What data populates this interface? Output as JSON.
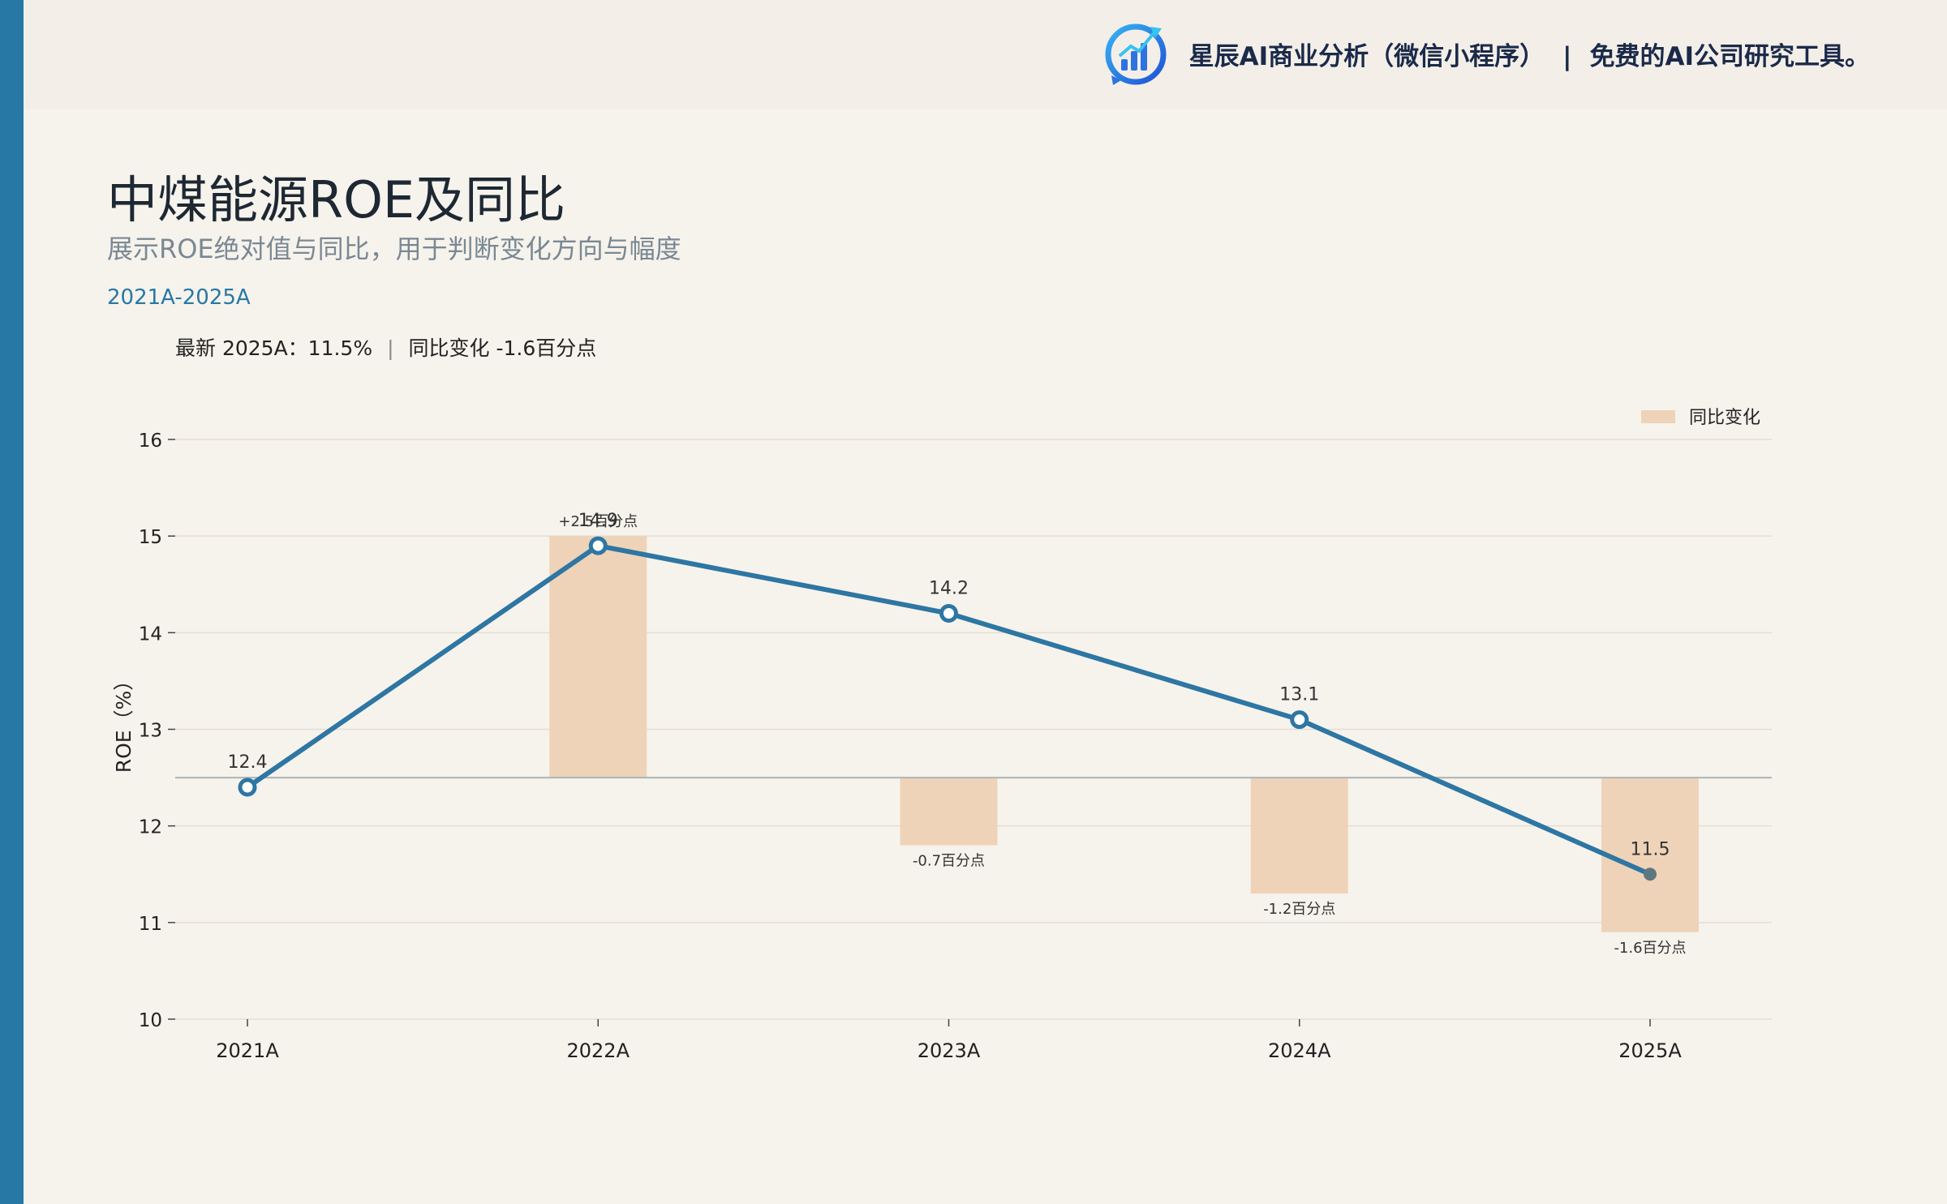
{
  "header": {
    "brand_name": "星辰AI商业分析（微信小程序）",
    "separator": "|",
    "tagline": "免费的AI公司研究工具。"
  },
  "title": "中煤能源ROE及同比",
  "subtitle": "展示ROE绝对值与同比，用于判断变化方向与幅度",
  "period": "2021A-2025A",
  "latest": {
    "label": "最新 2025A：11.5%",
    "separator": "|",
    "change": "同比变化 -1.6百分点"
  },
  "colors": {
    "accent": "#2878a5",
    "line": "#2e76a3",
    "bar": "#efd3b8",
    "last_point": "#5f7781",
    "background": "#f6f3ec"
  },
  "chart_data": {
    "type": "line",
    "categories": [
      "2021A",
      "2022A",
      "2023A",
      "2024A",
      "2025A"
    ],
    "series": [
      {
        "values": [
          12.4,
          14.9,
          14.2,
          13.1,
          11.5
        ],
        "data_labels": [
          "12.4",
          "14.9",
          "14.2",
          "13.1",
          "11.5"
        ]
      },
      {
        "name": "同比变化",
        "type": "bar",
        "values": [
          null,
          2.5,
          -0.7,
          -1.2,
          -1.6
        ],
        "data_labels": [
          "",
          "+2.5百分点",
          "-0.7百分点",
          "-1.2百分点",
          "-1.6百分点"
        ]
      }
    ],
    "ylabel": "ROE（%）",
    "ylim": [
      10,
      16.2
    ],
    "yticks": [
      10,
      11,
      12,
      13,
      14,
      15,
      16
    ],
    "bar_baseline": 12.5,
    "grid": true,
    "legend": "top-right"
  }
}
